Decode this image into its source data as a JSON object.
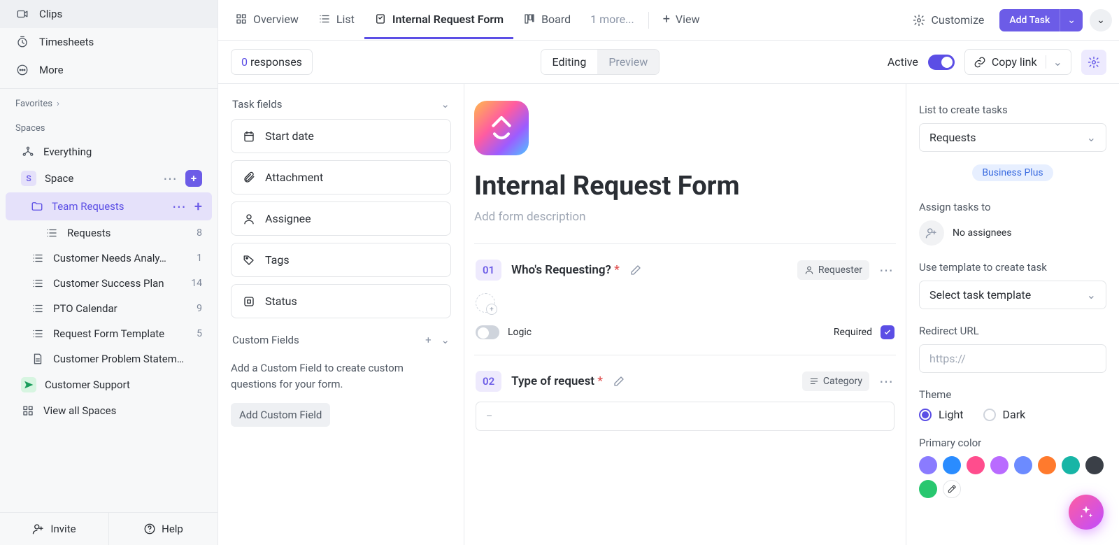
{
  "sidebar": {
    "top": [
      {
        "label": "Clips"
      },
      {
        "label": "Timesheets"
      },
      {
        "label": "More"
      }
    ],
    "favorites": "Favorites",
    "spaces_label": "Spaces",
    "spaces": {
      "everything": "Everything",
      "space_label": "Space",
      "space_initial": "S",
      "team_requests": "Team Requests",
      "requests": {
        "label": "Requests",
        "count": "8"
      },
      "items": [
        {
          "label": "Customer Needs Analy…",
          "count": "1"
        },
        {
          "label": "Customer Success Plan",
          "count": "14"
        },
        {
          "label": "PTO Calendar",
          "count": "9"
        },
        {
          "label": "Request Form Template",
          "count": "5"
        },
        {
          "label": "Customer Problem Statem…",
          "count": ""
        }
      ],
      "customer_support": "Customer Support",
      "view_all": "View all Spaces"
    },
    "footer": {
      "invite": "Invite",
      "help": "Help"
    }
  },
  "tabs": {
    "overview": "Overview",
    "list": "List",
    "form": "Internal Request Form",
    "board": "Board",
    "more": "1 more...",
    "view": "View",
    "customize": "Customize",
    "add_task": "Add Task"
  },
  "toolbar": {
    "responses_count": "0",
    "responses_label": "responses",
    "editing": "Editing",
    "preview": "Preview",
    "active": "Active",
    "copy_link": "Copy link"
  },
  "fields_panel": {
    "title": "Task fields",
    "fields": [
      "Start date",
      "Attachment",
      "Assignee",
      "Tags",
      "Status"
    ],
    "custom_title": "Custom Fields",
    "custom_desc": "Add a Custom Field to create custom questions for your form.",
    "add_cf": "Add Custom Field"
  },
  "form": {
    "title": "Internal Request Form",
    "desc_placeholder": "Add form description",
    "q1": {
      "num": "01",
      "title": "Who's Requesting?",
      "chip": "Requester",
      "logic": "Logic",
      "required": "Required"
    },
    "q2": {
      "num": "02",
      "title": "Type of request",
      "chip": "Category",
      "placeholder": "–"
    }
  },
  "settings": {
    "list_label": "List to create tasks",
    "list_value": "Requests",
    "plan": "Business Plus",
    "assign_label": "Assign tasks to",
    "no_assignees": "No assignees",
    "template_label": "Use template to create task",
    "template_value": "Select task template",
    "redirect_label": "Redirect URL",
    "redirect_placeholder": "https://",
    "theme_label": "Theme",
    "theme_light": "Light",
    "theme_dark": "Dark",
    "primary_label": "Primary color",
    "swatches": [
      "#8a7bff",
      "#2a8cff",
      "#ff4d8d",
      "#b96bff",
      "#6c8bff",
      "#ff7a2d",
      "#17b5a6",
      "#3a3f47",
      "#28c76f"
    ]
  }
}
